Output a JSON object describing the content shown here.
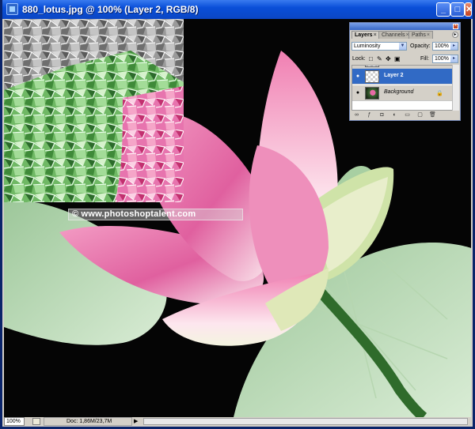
{
  "window": {
    "title": "880_lotus.jpg @ 100% (Layer 2, RGB/8)",
    "minimize_glyph": "_",
    "maximize_glyph": "□",
    "close_glyph": "✕"
  },
  "layers_panel": {
    "close_glyph": "×",
    "menu_glyph": "▸",
    "tabs": [
      {
        "label": "Layers",
        "active": true
      },
      {
        "label": "Channels",
        "active": false
      },
      {
        "label": "Paths",
        "active": false
      }
    ],
    "tab_close_glyph": "×",
    "blend_mode": "Luminosity",
    "opacity_label": "Opacity:",
    "opacity_value": "100%",
    "lock_label": "Lock:",
    "fill_label": "Fill:",
    "fill_value": "100%",
    "layers": [
      {
        "name": "Layer 2",
        "selected": true,
        "locked": false
      },
      {
        "name": "Background",
        "selected": false,
        "locked": true
      }
    ],
    "eye_glyph": "●",
    "lock_glyph": "🔒"
  },
  "statusbar": {
    "zoom": "100%",
    "doc_info": "Doc: 1,86M/23,7M",
    "arrow_glyph": "▶"
  },
  "watermark": {
    "text": "© www.photoshoptalent.com"
  },
  "colors": {
    "titlebar": "#0a4fd8",
    "selected_layer": "#316ac5",
    "panel_bg": "#d4d0c8"
  }
}
